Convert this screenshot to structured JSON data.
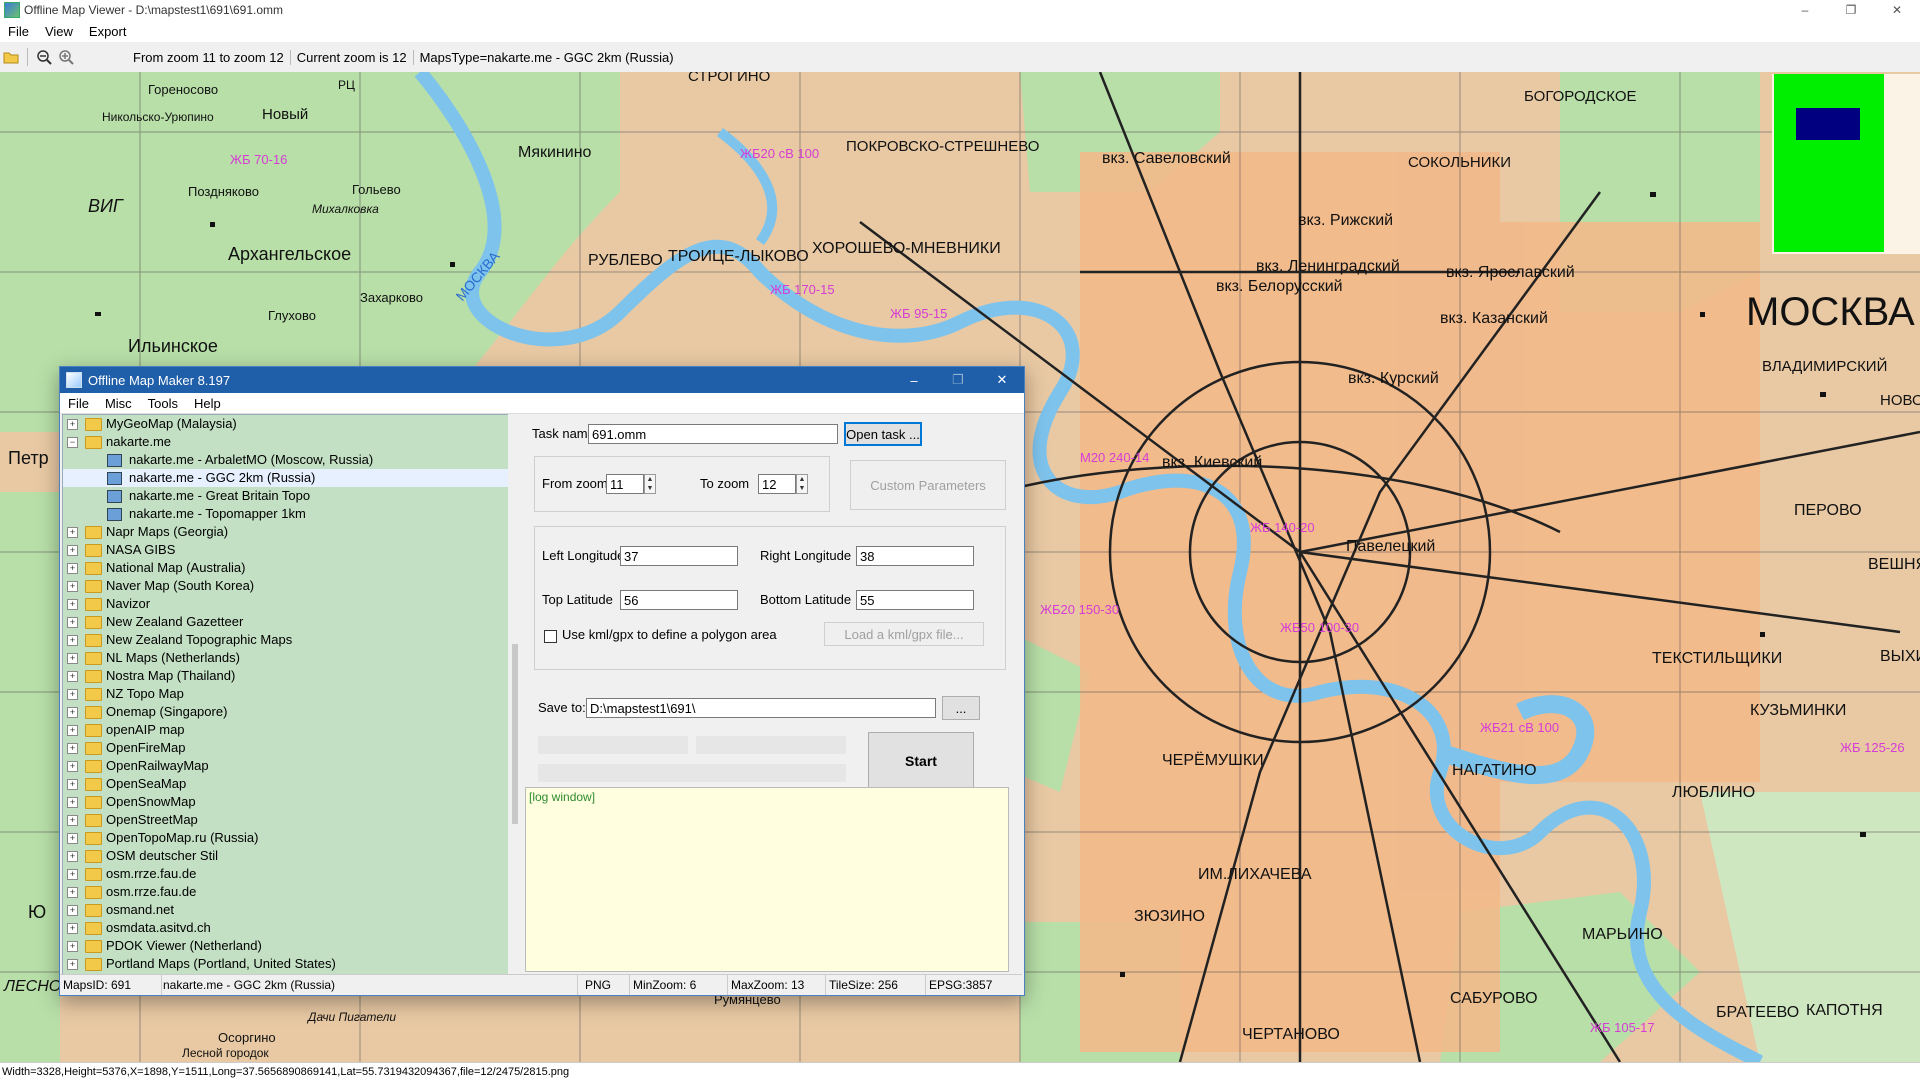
{
  "window": {
    "title": "Offline Map Viewer - D:\\mapstest1\\691\\691.omm",
    "controls": [
      "–",
      "❐",
      "✕"
    ]
  },
  "menu": [
    "File",
    "View",
    "Export"
  ],
  "toolbar": {
    "zoom_range": "From zoom 11 to zoom 12",
    "current_zoom": "Current zoom is 12",
    "maps_type": "MapsType=nakarte.me - GGC 2km (Russia)"
  },
  "map": {
    "labels": [
      "Гореносово",
      "Никольско-Урюпино",
      "Новый",
      "РЦ",
      "Мякинино",
      "СТРОГИНО",
      "ПОКРОВСКО-СТРЕШНЕВО",
      "вкз. Савеловский",
      "СОКОЛЬНИКИ",
      "БОГОРОДСКОЕ",
      "Поздняково",
      "Гольево",
      "Михалковка",
      "ВИГ",
      "Архангельское",
      "РУБЛЕВО",
      "ТРОИЦЕ-ЛЫКОВО",
      "ХОРОШЕВО-МНЕВНИКИ",
      "вкз. Рижский",
      "вкз. Ленинградский",
      "вкз. Белорусский",
      "вкз. Ярославский",
      "вкз. Казанский",
      "МОСКВА",
      "Захарково",
      "Глухово",
      "МОСКВА",
      "Ильинское",
      "вкз. Курский",
      "вкз. Киевский",
      "ВЛАДИМИРСКИЙ",
      "НОВОГИ",
      "ПЕРОВО",
      "Павелецкий",
      "ВЕШНЯКИ",
      "ТЕКСТИЛЬЩИКИ",
      "ВЫХИНО",
      "КУЗЬМИНКИ",
      "ЧЕРЁМУШКИ",
      "НАГАТИНО",
      "ЛЮБЛИНО",
      "ИМ.ЛИХАЧЕВА",
      "ЗЮЗИНО",
      "МАРЬИНО",
      "ЧЕРТАНОВО",
      "САБУРОВО",
      "БРАТЕЕВО",
      "КАПОТНЯ",
      "Осоргино",
      "Лесной городок",
      "Дачи Пигатели",
      "Румянцево",
      "Петр",
      "Ю",
      "ЛЕСНО"
    ]
  },
  "minimap": {
    "frame_color": "#00ee00",
    "view_color": "#000080"
  },
  "status_line": "Width=3328,Height=5376,X=1898,Y=1511,Long=37.5656890869141,Lat=55.7319432094367,file=12/2475/2815.png",
  "dialog": {
    "title": "Offline Map Maker 8.197",
    "menu": [
      "File",
      "Misc",
      "Tools",
      "Help"
    ],
    "tree": [
      {
        "label": "MyGeoMap (Malaysia)",
        "type": "folder",
        "expanded": false
      },
      {
        "label": "nakarte.me",
        "type": "folder",
        "expanded": true
      },
      {
        "label": "nakarte.me - ArbaletMO (Moscow, Russia)",
        "type": "leaf"
      },
      {
        "label": "nakarte.me - GGC 2km (Russia)",
        "type": "leaf",
        "selected": true
      },
      {
        "label": "nakarte.me - Great Britain Topo",
        "type": "leaf"
      },
      {
        "label": "nakarte.me - Topomapper 1km",
        "type": "leaf"
      },
      {
        "label": "Napr Maps (Georgia)",
        "type": "folder"
      },
      {
        "label": "NASA GIBS",
        "type": "folder"
      },
      {
        "label": "National Map (Australia)",
        "type": "folder"
      },
      {
        "label": "Naver Map (South Korea)",
        "type": "folder"
      },
      {
        "label": "Navizor",
        "type": "folder"
      },
      {
        "label": "New Zealand Gazetteer",
        "type": "folder"
      },
      {
        "label": "New Zealand Topographic Maps",
        "type": "folder"
      },
      {
        "label": "NL Maps (Netherlands)",
        "type": "folder"
      },
      {
        "label": "Nostra Map (Thailand)",
        "type": "folder"
      },
      {
        "label": "NZ Topo Map",
        "type": "folder"
      },
      {
        "label": "Onemap (Singapore)",
        "type": "folder"
      },
      {
        "label": "openAIP map",
        "type": "folder"
      },
      {
        "label": "OpenFireMap",
        "type": "folder"
      },
      {
        "label": "OpenRailwayMap",
        "type": "folder"
      },
      {
        "label": "OpenSeaMap",
        "type": "folder"
      },
      {
        "label": "OpenSnowMap",
        "type": "folder"
      },
      {
        "label": "OpenStreetMap",
        "type": "folder"
      },
      {
        "label": "OpenTopoMap.ru (Russia)",
        "type": "folder"
      },
      {
        "label": "OSM deutscher Stil",
        "type": "folder"
      },
      {
        "label": "osm.rrze.fau.de",
        "type": "folder"
      },
      {
        "label": "osm.rrze.fau.de",
        "type": "folder"
      },
      {
        "label": "osmand.net",
        "type": "folder"
      },
      {
        "label": "osmdata.asitvd.ch",
        "type": "folder"
      },
      {
        "label": "PDOK Viewer (Netherland)",
        "type": "folder"
      },
      {
        "label": "Portland Maps (Portland, United States)",
        "type": "folder"
      }
    ],
    "form": {
      "task_name_label": "Task name",
      "task_name_value": "691.omm",
      "open_task_button": "Open task ...",
      "from_zoom_label": "From zoom",
      "from_zoom_value": "11",
      "to_zoom_label": "To zoom",
      "to_zoom_value": "12",
      "custom_params_button": "Custom Parameters",
      "left_long_label": "Left Longitude",
      "left_long_value": "37",
      "right_long_label": "Right Longitude",
      "right_long_value": "38",
      "top_lat_label": "Top Latitude",
      "top_lat_value": "56",
      "bottom_lat_label": "Bottom Latitude",
      "bottom_lat_value": "55",
      "kml_checkbox_label": "Use kml/gpx to define a polygon area",
      "load_kml_button": "Load a kml/gpx file...",
      "save_to_label": "Save to:",
      "save_to_value": "D:\\mapstest1\\691\\",
      "browse_button": "...",
      "start_button": "Start"
    },
    "log": "[log window]",
    "status": {
      "maps_id": "MapsID: 691",
      "map_name": "nakarte.me - GGC 2km (Russia)",
      "format": "PNG",
      "min_zoom": "MinZoom: 6",
      "max_zoom": "MaxZoom: 13",
      "tile_size": "TileSize: 256",
      "epsg": "EPSG:3857"
    }
  }
}
